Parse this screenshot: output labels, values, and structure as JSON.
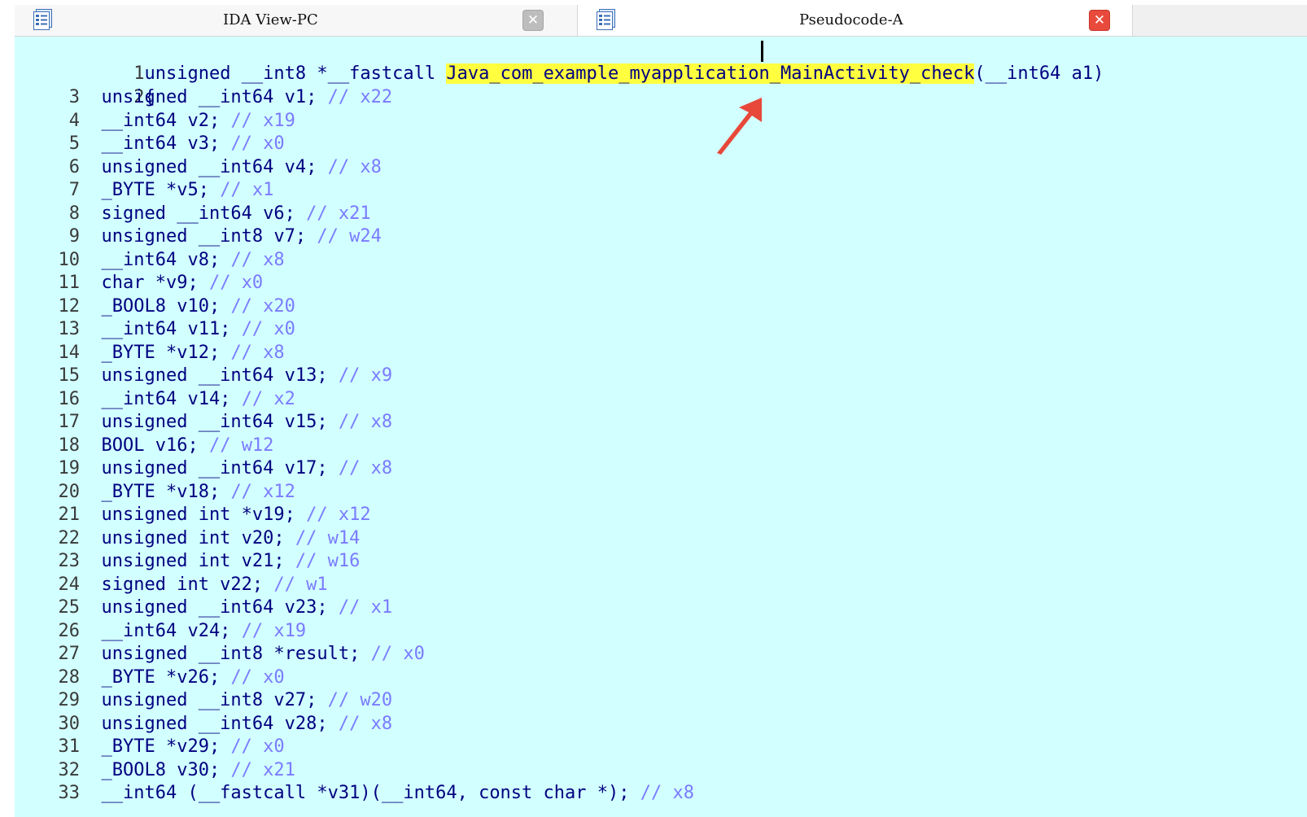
{
  "tabs": [
    {
      "label": "IDA View-PC",
      "icon": "document-list-icon",
      "close": "✕"
    },
    {
      "label": "Pseudocode-A",
      "icon": "document-list-icon",
      "close": "✕"
    }
  ],
  "colors": {
    "editor_bg": "#d2ffff",
    "code_text": "#000080",
    "comment": "#7b7bff",
    "highlight": "#ffff40",
    "annotation_arrow": "#e8483a"
  },
  "code": {
    "line1": {
      "num": "1",
      "pre": "unsigned __int8 *__fastcall ",
      "hl_a": "Java_com_example_myapplication_Main",
      "hl_b": "Activity_check",
      "post": "(__int64 a1)"
    },
    "line2": {
      "num": "2",
      "text": "{"
    },
    "lines": [
      {
        "num": "3",
        "text": "  unsigned __int64 v1; ",
        "comment": "// x22"
      },
      {
        "num": "4",
        "text": "  __int64 v2; ",
        "comment": "// x19"
      },
      {
        "num": "5",
        "text": "  __int64 v3; ",
        "comment": "// x0"
      },
      {
        "num": "6",
        "text": "  unsigned __int64 v4; ",
        "comment": "// x8"
      },
      {
        "num": "7",
        "text": "  _BYTE *v5; ",
        "comment": "// x1"
      },
      {
        "num": "8",
        "text": "  signed __int64 v6; ",
        "comment": "// x21"
      },
      {
        "num": "9",
        "text": "  unsigned __int8 v7; ",
        "comment": "// w24"
      },
      {
        "num": "10",
        "text": "  __int64 v8; ",
        "comment": "// x8"
      },
      {
        "num": "11",
        "text": "  char *v9; ",
        "comment": "// x0"
      },
      {
        "num": "12",
        "text": "  _BOOL8 v10; ",
        "comment": "// x20"
      },
      {
        "num": "13",
        "text": "  __int64 v11; ",
        "comment": "// x0"
      },
      {
        "num": "14",
        "text": "  _BYTE *v12; ",
        "comment": "// x8"
      },
      {
        "num": "15",
        "text": "  unsigned __int64 v13; ",
        "comment": "// x9"
      },
      {
        "num": "16",
        "text": "  __int64 v14; ",
        "comment": "// x2"
      },
      {
        "num": "17",
        "text": "  unsigned __int64 v15; ",
        "comment": "// x8"
      },
      {
        "num": "18",
        "text": "  BOOL v16; ",
        "comment": "// w12"
      },
      {
        "num": "19",
        "text": "  unsigned __int64 v17; ",
        "comment": "// x8"
      },
      {
        "num": "20",
        "text": "  _BYTE *v18; ",
        "comment": "// x12"
      },
      {
        "num": "21",
        "text": "  unsigned int *v19; ",
        "comment": "// x12"
      },
      {
        "num": "22",
        "text": "  unsigned int v20; ",
        "comment": "// w14"
      },
      {
        "num": "23",
        "text": "  unsigned int v21; ",
        "comment": "// w16"
      },
      {
        "num": "24",
        "text": "  signed int v22; ",
        "comment": "// w1"
      },
      {
        "num": "25",
        "text": "  unsigned __int64 v23; ",
        "comment": "// x1"
      },
      {
        "num": "26",
        "text": "  __int64 v24; ",
        "comment": "// x19"
      },
      {
        "num": "27",
        "text": "  unsigned __int8 *result; ",
        "comment": "// x0"
      },
      {
        "num": "28",
        "text": "  _BYTE *v26; ",
        "comment": "// x0"
      },
      {
        "num": "29",
        "text": "  unsigned __int8 v27; ",
        "comment": "// w20"
      },
      {
        "num": "30",
        "text": "  unsigned __int64 v28; ",
        "comment": "// x8"
      },
      {
        "num": "31",
        "text": "  _BYTE *v29; ",
        "comment": "// x0"
      },
      {
        "num": "32",
        "text": "  _BOOL8 v30; ",
        "comment": "// x21"
      },
      {
        "num": "33",
        "text": "  __int64 (__fastcall *v31)(__int64, const char *); ",
        "comment": "// x8"
      }
    ]
  }
}
